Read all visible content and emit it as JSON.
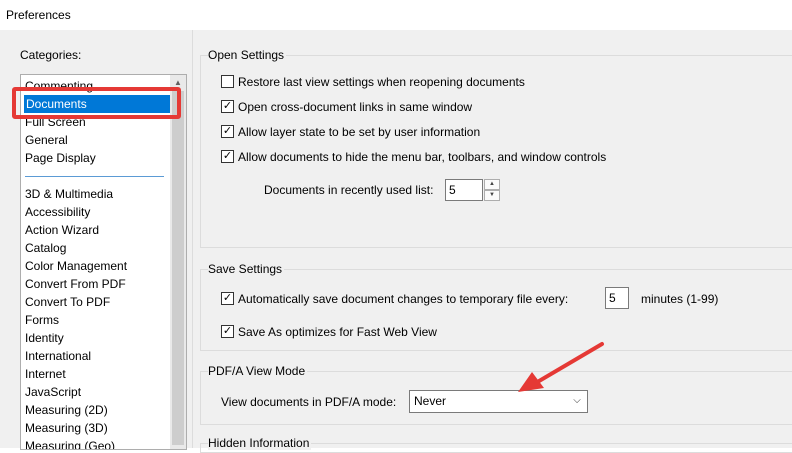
{
  "window": {
    "title": "Preferences"
  },
  "categories": {
    "label": "Categories:",
    "items": [
      {
        "label": "Commenting"
      },
      {
        "label": "Documents",
        "selected": true
      },
      {
        "label": "Full Screen"
      },
      {
        "label": "General"
      },
      {
        "label": "Page Display"
      },
      {
        "label": "3D & Multimedia"
      },
      {
        "label": "Accessibility"
      },
      {
        "label": "Action Wizard"
      },
      {
        "label": "Catalog"
      },
      {
        "label": "Color Management"
      },
      {
        "label": "Convert From PDF"
      },
      {
        "label": "Convert To PDF"
      },
      {
        "label": "Forms"
      },
      {
        "label": "Identity"
      },
      {
        "label": "International"
      },
      {
        "label": "Internet"
      },
      {
        "label": "JavaScript"
      },
      {
        "label": "Measuring (2D)"
      },
      {
        "label": "Measuring (3D)"
      },
      {
        "label": "Measuring (Geo)"
      }
    ]
  },
  "open_settings": {
    "title": "Open Settings",
    "restore_last_view": {
      "label": "Restore last view settings when reopening documents",
      "checked": false
    },
    "open_cross_doc_links": {
      "label": "Open cross-document links in same window",
      "checked": true
    },
    "allow_layer_state": {
      "label": "Allow layer state to be set by user information",
      "checked": true
    },
    "allow_hide_menu": {
      "label": "Allow documents to hide the menu bar, toolbars, and window controls",
      "checked": true
    },
    "recent_list_label": "Documents in recently used list:",
    "recent_list_value": "5"
  },
  "save_settings": {
    "title": "Save Settings",
    "auto_save": {
      "label": "Automatically save document changes to temporary file every:",
      "checked": true
    },
    "auto_save_minutes": "5",
    "minutes_suffix": "minutes (1-99)",
    "save_as_optimizes": {
      "label": "Save As optimizes for Fast Web View",
      "checked": true
    }
  },
  "pdfa_mode": {
    "title": "PDF/A View Mode",
    "view_label": "View documents in PDF/A mode:",
    "view_value": "Never"
  },
  "hidden_information": {
    "title": "Hidden Information"
  },
  "icons": {
    "check": "✓",
    "dropdown": "chevron-down",
    "annotation": "red-arrow"
  },
  "colors": {
    "selection": "#0078d7",
    "highlight_box": "#e53935"
  }
}
